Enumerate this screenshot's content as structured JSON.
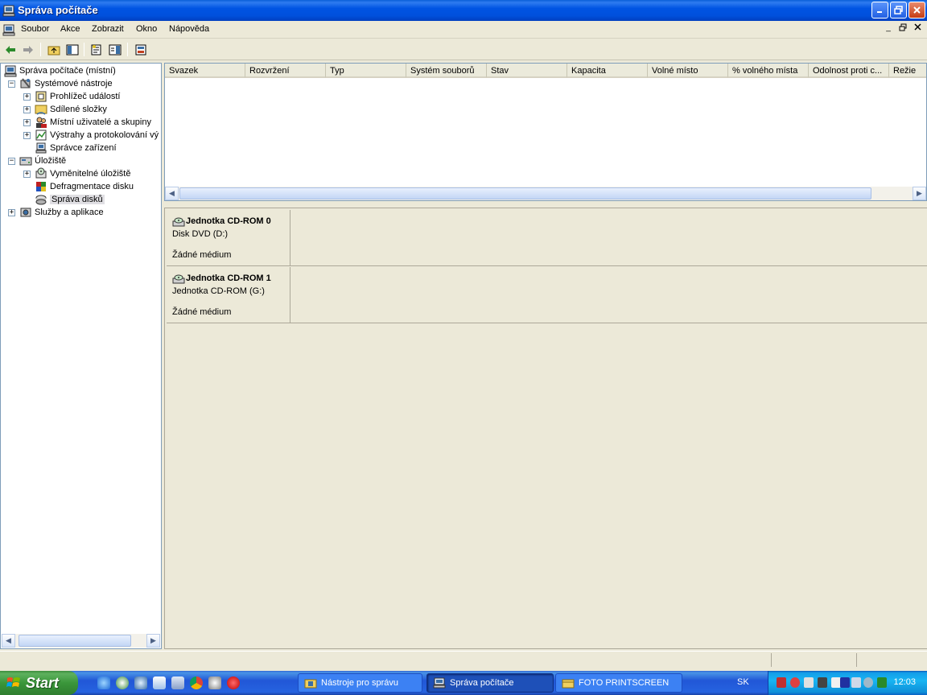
{
  "window": {
    "title": "Správa počítače"
  },
  "menu": [
    "Soubor",
    "Akce",
    "Zobrazit",
    "Okno",
    "Nápověda"
  ],
  "tree": {
    "root": "Správa počítače (místní)",
    "items": [
      "Systémové nástroje",
      "Prohlížeč událostí",
      "Sdílené složky",
      "Místní uživatelé a skupiny",
      "Výstrahy a protokolování vý",
      "Správce zařízení",
      "Úložiště",
      "Vyměnitelné úložiště",
      "Defragmentace disku",
      "Správa disků",
      "Služby a aplikace"
    ]
  },
  "columns": [
    "Svazek",
    "Rozvržení",
    "Typ",
    "Systém souborů",
    "Stav",
    "Kapacita",
    "Volné místo",
    "% volného místa",
    "Odolnost proti c...",
    "Režie"
  ],
  "disks": [
    {
      "title": "Jednotka CD-ROM 0",
      "device": "Disk DVD (D:)",
      "status": "Žádné médium"
    },
    {
      "title": "Jednotka CD-ROM 1",
      "device": "Jednotka CD-ROM (G:)",
      "status": "Žádné médium"
    }
  ],
  "taskbar": {
    "start": "Start",
    "tasks": [
      "Nástroje pro správu",
      "Správa počítače",
      "FOTO PRINTSCREEN"
    ],
    "language": "SK",
    "clock": "12:03"
  },
  "colors": {
    "titlebar": "#0054e3",
    "taskbar": "#2157d7",
    "start": "#3a963a",
    "tray": "#18b5f2"
  }
}
